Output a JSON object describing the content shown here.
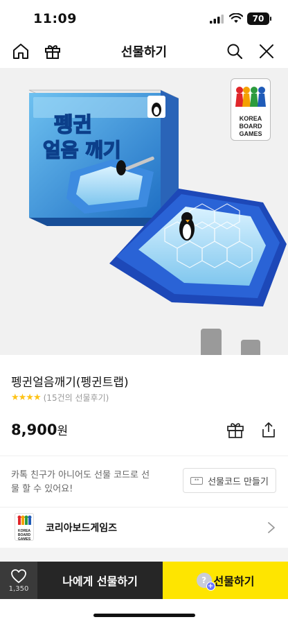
{
  "status_bar": {
    "time": "11:09",
    "battery": "70"
  },
  "header": {
    "title": "선물하기",
    "icons": [
      "home-icon",
      "gift-icon",
      "search-icon",
      "close-icon"
    ]
  },
  "product_image": {
    "box_title_line1": "펭귄",
    "box_title_line2": "얼음 깨기",
    "brand_logo_text": "KOREA\nBOARD\nGAMES"
  },
  "product": {
    "name": "펭귄얼음깨기(펭귄트랩)",
    "stars": "★★★★",
    "rating_value": 4,
    "review_count": "(15건의 선물후기)",
    "price": "8,900",
    "price_suffix": "원",
    "accent_star_color": "#fdc318"
  },
  "gift_code": {
    "notice": "카톡 친구가 아니어도 선물 코드로 선물 할 수 있어요!",
    "button_label": "선물코드 만들기",
    "icon_text": "**"
  },
  "brand": {
    "name": "코리아보드게임즈",
    "thumb_text": "KOREA\nBOARD\nGAMES"
  },
  "bottom_bar": {
    "wish_count": "1,350",
    "self_gift_label": "나에게 선물하기",
    "send_gift_label": "선물하기",
    "bubble_mark": "?",
    "bubble_plus": "+",
    "accent_color": "#fee500"
  }
}
